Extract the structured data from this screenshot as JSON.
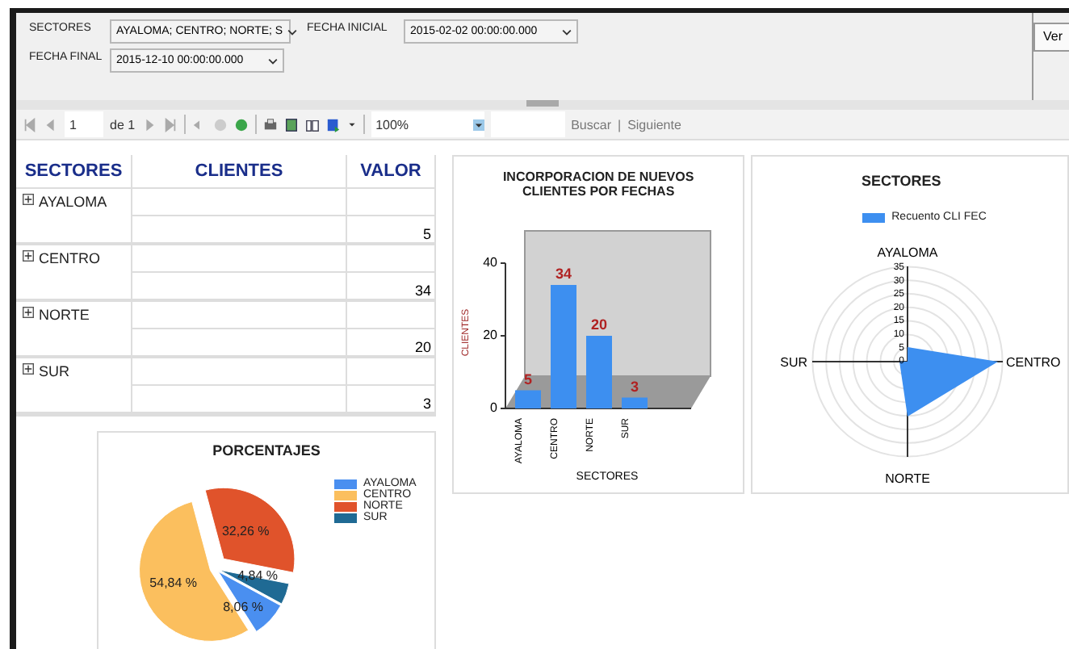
{
  "parameters": [
    {
      "label": "SECTORES",
      "value": "AYALOMA; CENTRO; NORTE; S"
    },
    {
      "label": "FECHA INICIAL",
      "value": "2015-02-02 00:00:00.000"
    },
    {
      "label": "FECHA FINAL",
      "value": "2015-12-10 00:00:00.000"
    }
  ],
  "view_button": "Ver",
  "toolbar": {
    "page": "1",
    "page_count": "de 1",
    "zoom": "100%",
    "find_label": "Buscar",
    "separator": "|",
    "next_label": "Siguiente"
  },
  "table": {
    "columns": [
      "SECTORES",
      "CLIENTES",
      "VALOR"
    ],
    "rows": [
      {
        "sector": "AYALOMA",
        "value": "5",
        "expanded": false
      },
      {
        "sector": "CENTRO",
        "value": "34",
        "expanded": false
      },
      {
        "sector": "NORTE",
        "value": "20",
        "expanded": false
      },
      {
        "sector": "SUR",
        "value": "3",
        "expanded": false
      }
    ]
  },
  "pie": {
    "legend": [
      {
        "color": "#4a8ff0"
      },
      {
        "color": "#fbbf5e"
      },
      {
        "color": "#e0532b"
      },
      {
        "color": "#1f6a94"
      }
    ],
    "chart_data": {
      "type": "pie",
      "title": "PORCENTAJES",
      "categories": [
        "AYALOMA",
        "CENTRO",
        "NORTE",
        "SUR"
      ],
      "values": [
        8.06,
        54.84,
        32.26,
        4.84
      ],
      "value_labels": [
        "8,06 %",
        "54,84 %",
        "32,26 %",
        "4,84 %"
      ]
    }
  },
  "bar": {
    "chart_data": {
      "type": "bar",
      "title": "INCORPORACION DE NUEVOS CLIENTES POR FECHAS",
      "xlabel": "SECTORES",
      "ylabel": "CLIENTES",
      "categories": [
        "AYALOMA",
        "CENTRO",
        "NORTE",
        "SUR"
      ],
      "values": [
        5,
        34,
        20,
        3
      ],
      "ylim": [
        0,
        40
      ],
      "yticks": [
        0,
        20,
        40
      ],
      "data_labels": true
    }
  },
  "radar": {
    "title": "SECTORES",
    "legend": "Recuento CLI FEC",
    "axes": [
      {
        "label": "AYALOMA"
      },
      {
        "label": "CENTRO"
      },
      {
        "label": "NORTE"
      },
      {
        "label": "SUR"
      }
    ],
    "ticks": [
      "35",
      "30",
      "25",
      "20",
      "15",
      "10",
      "5",
      "0"
    ]
  }
}
